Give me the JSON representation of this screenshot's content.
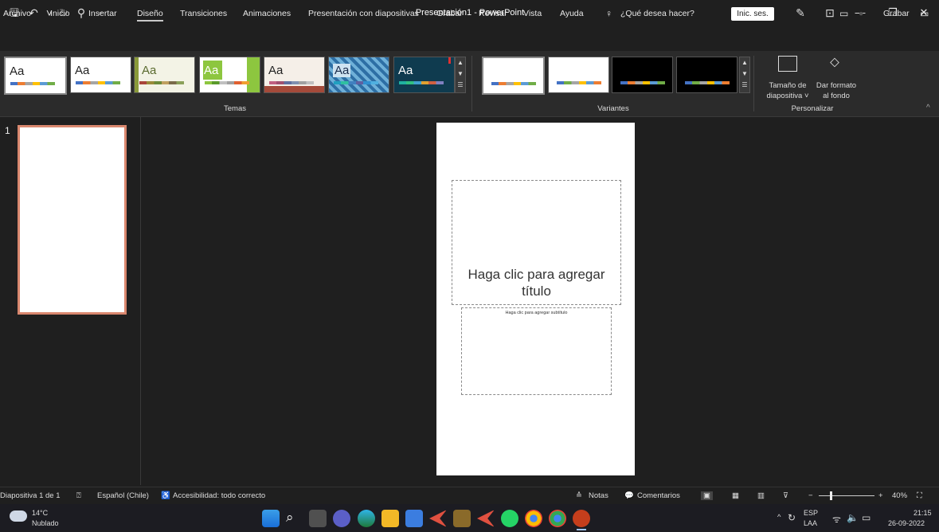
{
  "window": {
    "title": "Presentación1 - PowerPoint",
    "signin_label": "Inic. ses.",
    "icons": [
      "save-icon",
      "undo-icon",
      "redo-icon",
      "present-icon",
      "customize-icon",
      "pen-icon",
      "ribbon-display-icon",
      "minimize-icon",
      "restore-icon",
      "close-icon"
    ]
  },
  "menu": {
    "items": [
      "Archivo",
      "Inicio",
      "Insertar",
      "Diseño",
      "Transiciones",
      "Animaciones",
      "Presentación con diapositivas",
      "Grabar",
      "Revisar",
      "Vista",
      "Ayuda"
    ],
    "active": "Diseño",
    "tell_me": "¿Qué desea hacer?",
    "record": "Grabar"
  },
  "ribbon": {
    "themes_label": "Temas",
    "variants_label": "Variantes",
    "customize_label": "Personalizar",
    "themes": [
      {
        "text": "Aa",
        "bg": "#ffffff",
        "fg": "#222222"
      },
      {
        "text": "Aa",
        "bg": "#ffffff",
        "fg": "#222222"
      },
      {
        "text": "Aa",
        "bg": "#f3f3e6",
        "fg": "#5a6b2f"
      },
      {
        "text": "Aa",
        "bg": "#8dc63f",
        "fg": "#ffffff"
      },
      {
        "text": "Aa",
        "bg": "#f5efe8",
        "fg": "#222222"
      },
      {
        "text": "Aa",
        "bg": "#3c7fb5",
        "fg": "#1a2a4a"
      },
      {
        "text": "Aa",
        "bg": "#0f3b4f",
        "fg": "#ffffff"
      }
    ],
    "variants": [
      "#ffffff",
      "#ffffff",
      "#000000",
      "#000000"
    ],
    "slide_size": {
      "line1": "Tamaño de",
      "line2": "diapositiva ˅"
    },
    "format_bg": {
      "line1": "Dar formato",
      "line2": "al fondo"
    }
  },
  "slides": {
    "number": "1"
  },
  "slide": {
    "title_placeholder_line1": "Haga clic para agregar",
    "title_placeholder_line2": "título",
    "subtitle_placeholder": "Haga clic para agregar subtítulo"
  },
  "status": {
    "slide_info": "Diapositiva 1 de 1",
    "language": "Español (Chile)",
    "accessibility": "Accesibilidad: todo correcto",
    "notes": "Notas",
    "comments": "Comentarios",
    "zoom": "40%"
  },
  "taskbar": {
    "weather_temp": "14°C",
    "weather_desc": "Nublado",
    "lang1": "ESP",
    "lang2": "LAA",
    "time": "21:15",
    "date": "26-09-2022"
  }
}
